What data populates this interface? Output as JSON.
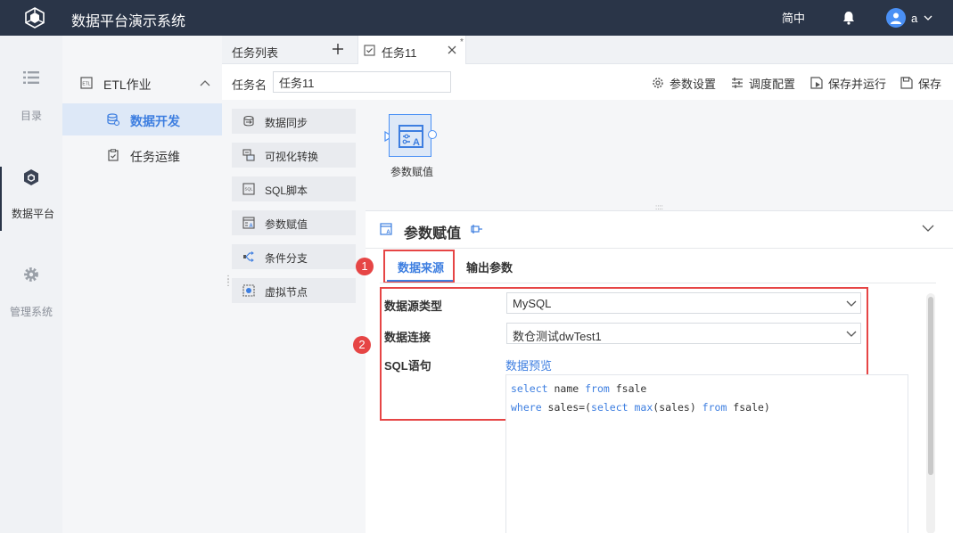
{
  "topbar": {
    "app_title": "数据平台演示系统",
    "language": "简中",
    "user_name": "a"
  },
  "rail": {
    "items": [
      {
        "label": "目录",
        "icon": "list-icon"
      },
      {
        "label": "数据平台",
        "icon": "platform-cube-icon"
      },
      {
        "label": "管理系统",
        "icon": "gear-icon"
      }
    ],
    "active_index": 1
  },
  "subnav": {
    "group_label": "ETL作业",
    "items": [
      {
        "label": "数据开发",
        "icon": "database-icon"
      },
      {
        "label": "任务运维",
        "icon": "clipboard-icon"
      }
    ],
    "active_index": 0
  },
  "tabs": {
    "list_title": "任务列表",
    "open_tab_label": "任务11",
    "modified_mark": "*"
  },
  "taskbar": {
    "task_name_label": "任务名",
    "task_name_value": "任务11",
    "buttons": {
      "params": "参数设置",
      "schedule": "调度配置",
      "save_run": "保存并运行",
      "save": "保存"
    }
  },
  "components": [
    {
      "label": "数据同步",
      "icon": "data-sync-icon"
    },
    {
      "label": "可视化转换",
      "icon": "visual-transform-icon"
    },
    {
      "label": "SQL脚本",
      "icon": "sql-script-icon"
    },
    {
      "label": "参数赋值",
      "icon": "param-assign-icon"
    },
    {
      "label": "条件分支",
      "icon": "condition-branch-icon"
    },
    {
      "label": "虚拟节点",
      "icon": "virtual-node-icon"
    }
  ],
  "canvas": {
    "node_label": "参数赋值"
  },
  "panel": {
    "title": "参数赋值",
    "tabs": [
      "数据来源",
      "输出参数"
    ],
    "active_tab": 0,
    "markers": [
      "1",
      "2"
    ],
    "fields": {
      "datasource_type_label": "数据源类型",
      "datasource_type_value": "MySQL",
      "connection_label": "数据连接",
      "connection_value": "数仓测试dwTest1",
      "sql_label": "SQL语句",
      "preview_link": "数据预览"
    },
    "sql": {
      "line1": {
        "kw1": "select",
        "t1": " name ",
        "kw2": "from",
        "t2": " fsale"
      },
      "line2": {
        "kw1": "where",
        "t1": " sales=(",
        "kw2": "select",
        "t2": " ",
        "kw3": "max",
        "t3": "(sales) ",
        "kw4": "from",
        "t4": " fsale)"
      }
    }
  },
  "colors": {
    "topbar_bg": "#2a3548",
    "accent": "#3d7ee0",
    "highlight_red": "#e64545"
  }
}
